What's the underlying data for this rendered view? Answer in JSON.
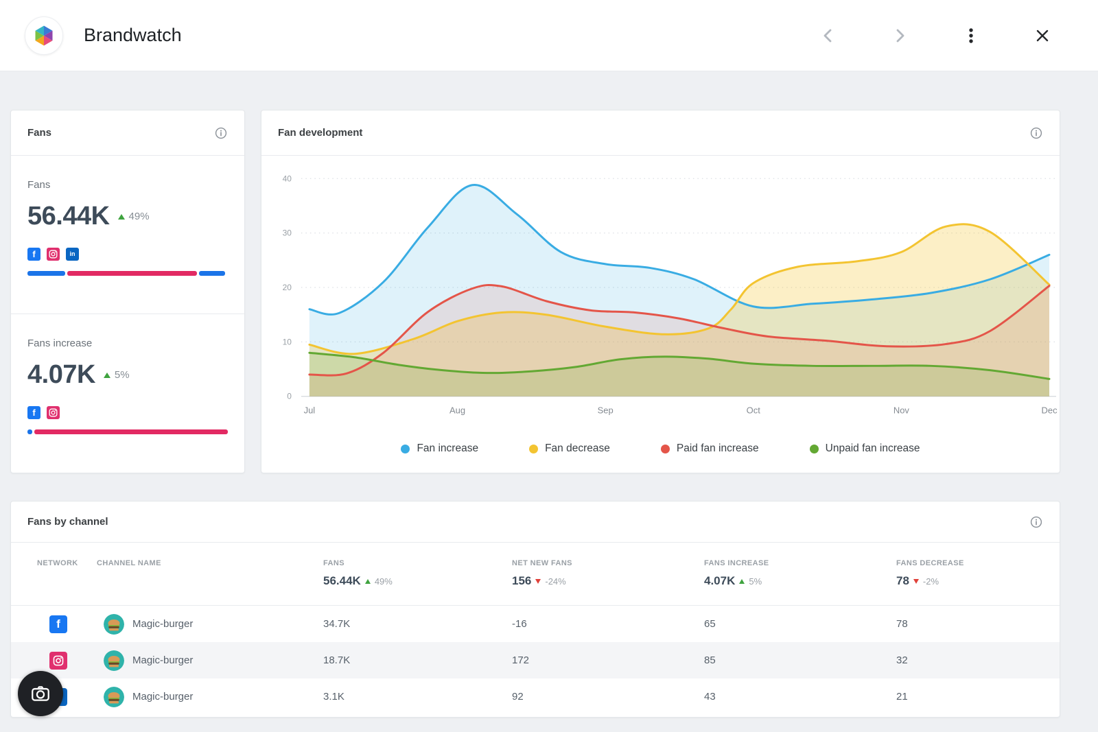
{
  "app": {
    "title": "Brandwatch"
  },
  "icons": {
    "facebook_glyph": "f",
    "linkedin_glyph": "in"
  },
  "fans_card": {
    "title": "Fans",
    "fans": {
      "label": "Fans",
      "value": "56.44K",
      "delta": "49%",
      "delta_dir": "up"
    },
    "increase": {
      "label": "Fans increase",
      "value": "4.07K",
      "delta": "5%",
      "delta_dir": "up"
    },
    "fans_bar": [
      {
        "color": "#1b74e8",
        "pct": 19
      },
      {
        "color": "#e22a63",
        "pct": 64.5
      },
      {
        "color": "#1b74e8",
        "pct": 13
      }
    ],
    "increase_bar": [
      {
        "color": "#1b74e8",
        "pct": 2.5
      },
      {
        "color": "#e22a63",
        "pct": 96.5
      }
    ]
  },
  "chart_card": {
    "title": "Fan development"
  },
  "chart_data": {
    "type": "area",
    "title": "Fan development",
    "x_labels": [
      "Jul",
      "Aug",
      "Sep",
      "Oct",
      "Nov",
      "Dec"
    ],
    "y_ticks": [
      0,
      10,
      20,
      30,
      40
    ],
    "y_max": 40,
    "grid": "dotted horizontal",
    "legend_position": "bottom",
    "series": [
      {
        "name": "Fan increase",
        "color": "#39ACE3",
        "fill_opacity": 0.16,
        "points": [
          [
            0,
            16
          ],
          [
            0.2,
            15.3
          ],
          [
            0.5,
            21
          ],
          [
            0.8,
            31
          ],
          [
            1.1,
            38.8
          ],
          [
            1.4,
            33.5
          ],
          [
            1.7,
            26.5
          ],
          [
            2,
            24.3
          ],
          [
            2.3,
            23.6
          ],
          [
            2.6,
            21.5
          ],
          [
            3,
            16.5
          ],
          [
            3.4,
            17
          ],
          [
            3.8,
            17.8
          ],
          [
            4.2,
            19
          ],
          [
            4.6,
            21.5
          ],
          [
            5,
            26
          ]
        ]
      },
      {
        "name": "Fan decrease",
        "color": "#F3C431",
        "fill_opacity": 0.28,
        "points": [
          [
            0,
            9.5
          ],
          [
            0.3,
            7.8
          ],
          [
            0.7,
            10.5
          ],
          [
            1,
            13.8
          ],
          [
            1.3,
            15.4
          ],
          [
            1.6,
            15
          ],
          [
            2,
            12.8
          ],
          [
            2.4,
            11.4
          ],
          [
            2.7,
            12.5
          ],
          [
            2.85,
            16
          ],
          [
            3,
            20.8
          ],
          [
            3.3,
            23.8
          ],
          [
            3.7,
            24.8
          ],
          [
            4,
            26.5
          ],
          [
            4.3,
            31.2
          ],
          [
            4.6,
            30.2
          ],
          [
            5,
            20.5
          ]
        ]
      },
      {
        "name": "Paid fan increase",
        "color": "#E45549",
        "fill_opacity": 0.13,
        "points": [
          [
            0,
            4
          ],
          [
            0.25,
            4.2
          ],
          [
            0.5,
            8
          ],
          [
            0.8,
            15.5
          ],
          [
            1.1,
            19.8
          ],
          [
            1.3,
            20.2
          ],
          [
            1.6,
            17.5
          ],
          [
            1.9,
            15.8
          ],
          [
            2.2,
            15.4
          ],
          [
            2.5,
            14.3
          ],
          [
            2.8,
            12.5
          ],
          [
            3.1,
            11
          ],
          [
            3.5,
            10.2
          ],
          [
            3.9,
            9.2
          ],
          [
            4.3,
            9.6
          ],
          [
            4.6,
            12
          ],
          [
            5,
            20.3
          ]
        ]
      },
      {
        "name": "Unpaid fan increase",
        "color": "#63A833",
        "fill_opacity": 0.18,
        "points": [
          [
            0,
            8
          ],
          [
            0.3,
            7.2
          ],
          [
            0.6,
            5.8
          ],
          [
            0.9,
            4.8
          ],
          [
            1.2,
            4.3
          ],
          [
            1.5,
            4.6
          ],
          [
            1.8,
            5.4
          ],
          [
            2.1,
            6.8
          ],
          [
            2.4,
            7.3
          ],
          [
            2.7,
            6.9
          ],
          [
            3,
            6
          ],
          [
            3.4,
            5.6
          ],
          [
            3.8,
            5.6
          ],
          [
            4.2,
            5.6
          ],
          [
            4.6,
            4.8
          ],
          [
            5,
            3.2
          ]
        ]
      }
    ]
  },
  "table_card": {
    "title": "Fans by channel",
    "columns": [
      "Network",
      "Channel name",
      "Fans",
      "Net new fans",
      "Fans increase",
      "Fans decrease"
    ],
    "summary": {
      "fans": {
        "value": "56.44K",
        "delta": "49%",
        "dir": "up"
      },
      "net_new_fans": {
        "value": "156",
        "delta": "-24%",
        "dir": "down"
      },
      "fans_increase": {
        "value": "4.07K",
        "delta": "5%",
        "dir": "up"
      },
      "fans_decrease": {
        "value": "78",
        "delta": "-2%",
        "dir": "down"
      }
    },
    "rows": [
      {
        "network": "facebook",
        "channel": "Magic-burger",
        "fans": "34.7K",
        "net_new_fans": "-16",
        "fans_increase": "65",
        "fans_decrease": "78"
      },
      {
        "network": "instagram",
        "channel": "Magic-burger",
        "fans": "18.7K",
        "net_new_fans": "172",
        "fans_increase": "85",
        "fans_decrease": "32"
      },
      {
        "network": "linkedin",
        "channel": "Magic-burger",
        "fans": "3.1K",
        "net_new_fans": "92",
        "fans_increase": "43",
        "fans_decrease": "21"
      }
    ]
  }
}
